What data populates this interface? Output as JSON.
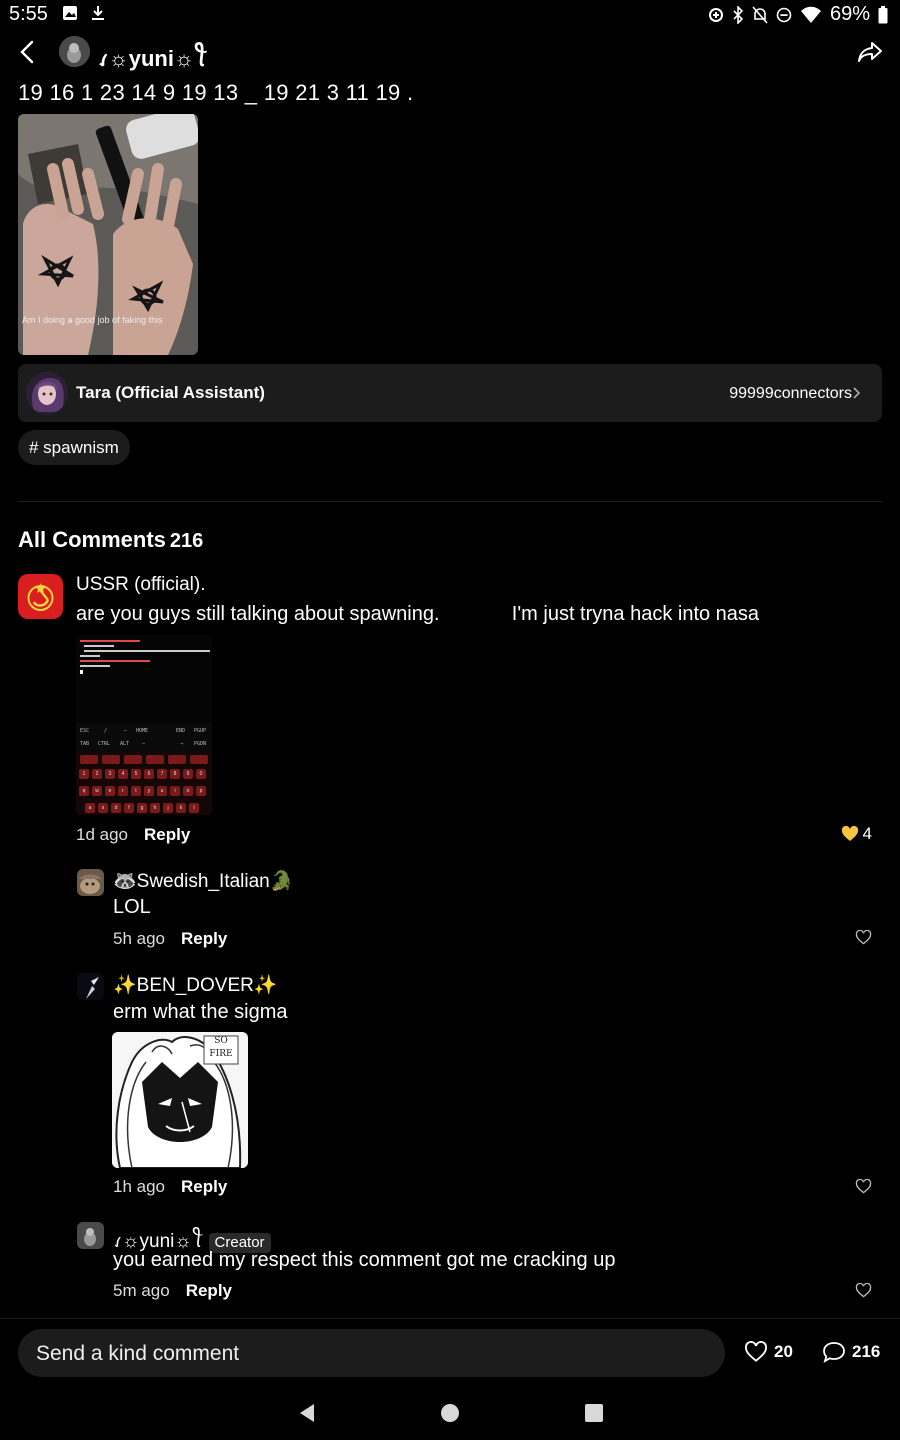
{
  "status_bar": {
    "time": "5:55",
    "battery": "69%",
    "left_icons": [
      "image-icon",
      "download-icon"
    ],
    "right_icons": [
      "data-saver-icon",
      "bluetooth-icon",
      "notifications-off-icon",
      "do-not-disturb-icon",
      "wifi-icon",
      "battery-icon"
    ]
  },
  "header": {
    "title": "ꪹ☼yuni☼ꪻ"
  },
  "post": {
    "text": "19 16 1 23 14 9 19 13 _ 19 21 3 11 19 .",
    "image_caption": "Am I doing a good job of faking this"
  },
  "assistant": {
    "name": "Tara (Official Assistant)",
    "connectors": "99999connectors"
  },
  "tag": "# spawnism",
  "comments_section": {
    "title": "All Comments",
    "count": "216"
  },
  "comments": [
    {
      "user": "USSR (official).",
      "text": "are you guys still talking about spawning.             I'm just tryna hack into nasa",
      "time": "1d ago",
      "reply": "Reply",
      "likes": "4",
      "liked": true
    },
    {
      "user": "🦝Swedish_Italian🐊",
      "text": "LOL",
      "time": "5h ago",
      "reply": "Reply"
    },
    {
      "user": "✨BEN_DOVER✨",
      "text": "erm what the sigma",
      "time": "1h ago",
      "reply": "Reply",
      "image_text": "SO FIRE"
    },
    {
      "user": "ꪹ☼yuni☼ꪻ",
      "badge": "Creator",
      "text": "you earned my respect this comment got me cracking up",
      "time": "5m ago",
      "reply": "Reply"
    }
  ],
  "bottom_bar": {
    "placeholder": "Send a kind comment",
    "likes": "20",
    "comments": "216"
  },
  "terminal_keys": {
    "row1": [
      "1",
      "2",
      "3",
      "4",
      "5",
      "6",
      "7",
      "8",
      "9",
      "0"
    ],
    "row2": [
      "q",
      "w",
      "e",
      "r",
      "t",
      "y",
      "u",
      "i",
      "o",
      "p"
    ],
    "row3": [
      "a",
      "s",
      "d",
      "f",
      "g",
      "h",
      "j",
      "k",
      "l"
    ]
  },
  "colors": {
    "background": "#000000",
    "surface": "#1c1c1c",
    "like_active": "#f5c542",
    "ussr_red": "#d81e1e"
  }
}
